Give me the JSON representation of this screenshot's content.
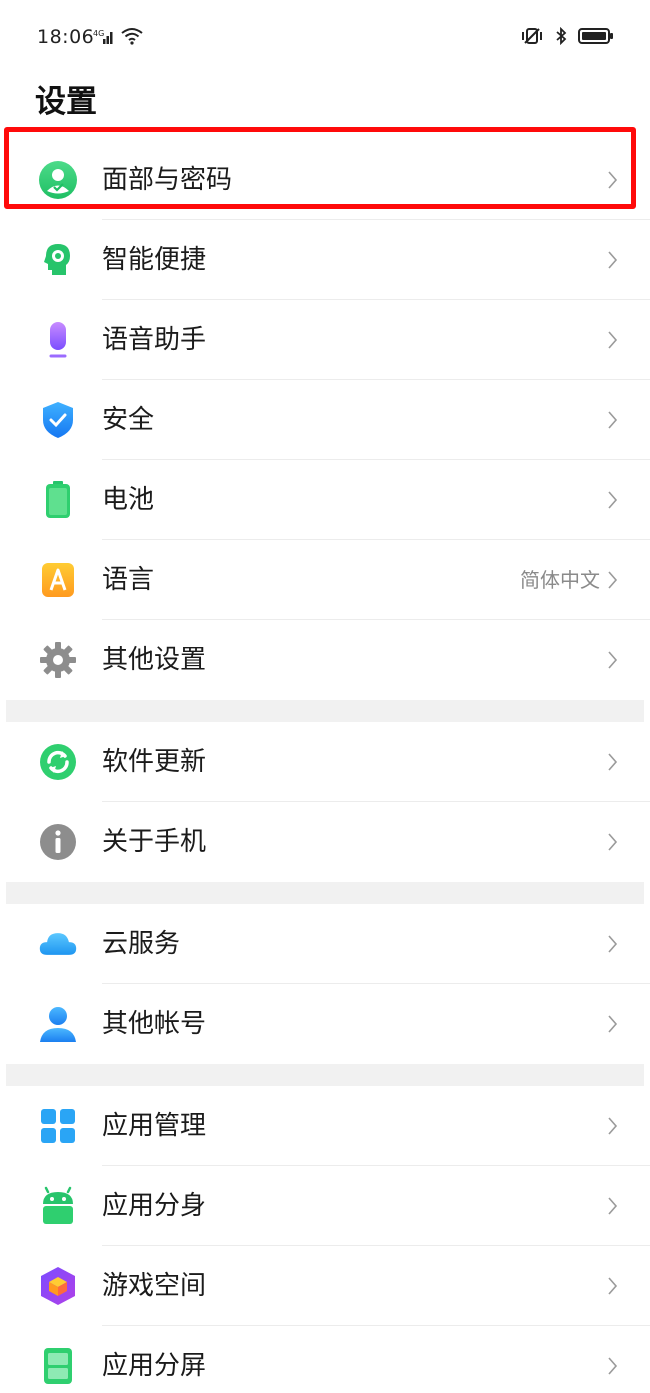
{
  "status": {
    "time": "18:06"
  },
  "page": {
    "title": "设置"
  },
  "groups": [
    {
      "items": [
        {
          "label": "面部与密码",
          "icon": "face-user-icon"
        },
        {
          "label": "智能便捷",
          "icon": "smart-head-icon"
        },
        {
          "label": "语音助手",
          "icon": "microphone-icon"
        },
        {
          "label": "安全",
          "icon": "shield-check-icon"
        },
        {
          "label": "电池",
          "icon": "battery-icon"
        },
        {
          "label": "语言",
          "icon": "language-a-icon",
          "value": "简体中文"
        },
        {
          "label": "其他设置",
          "icon": "gear-icon"
        }
      ]
    },
    {
      "items": [
        {
          "label": "软件更新",
          "icon": "update-refresh-icon"
        },
        {
          "label": "关于手机",
          "icon": "info-icon"
        }
      ]
    },
    {
      "items": [
        {
          "label": "云服务",
          "icon": "cloud-icon"
        },
        {
          "label": "其他帐号",
          "icon": "person-icon"
        }
      ]
    },
    {
      "items": [
        {
          "label": "应用管理",
          "icon": "app-grid-icon"
        },
        {
          "label": "应用分身",
          "icon": "android-clone-icon"
        },
        {
          "label": "游戏空间",
          "icon": "game-cube-icon"
        },
        {
          "label": "应用分屏",
          "icon": "split-screen-icon"
        }
      ]
    }
  ],
  "colors": {
    "highlight": "#ff0a0a",
    "accent_green": "#2fcf6f",
    "accent_blue": "#2196f3"
  }
}
